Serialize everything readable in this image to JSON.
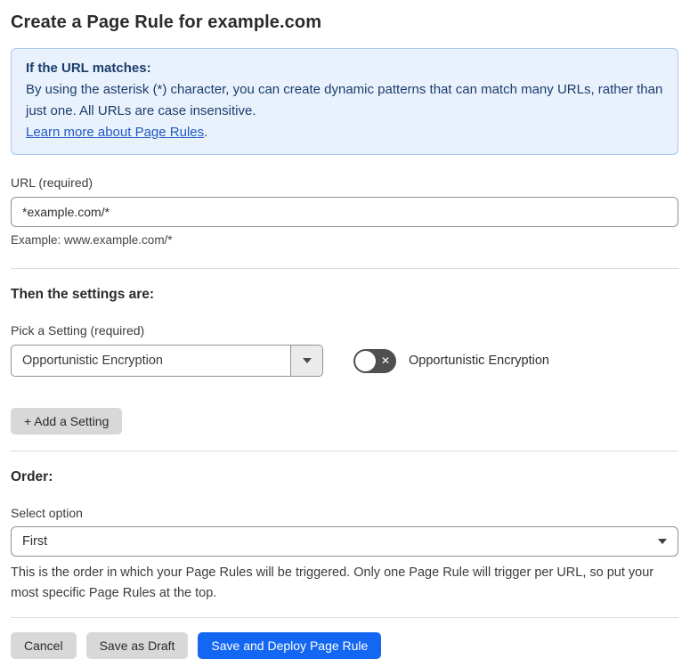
{
  "page": {
    "title": "Create a Page Rule for example.com"
  },
  "info_box": {
    "heading": "If the URL matches:",
    "body": "By using the asterisk (*) character, you can create dynamic patterns that can match many URLs, rather than just one. All URLs are case insensitive.",
    "link_label": "Learn more about Page Rules",
    "link_suffix": "."
  },
  "url_field": {
    "label": "URL (required)",
    "value": "*example.com/*",
    "hint": "Example: www.example.com/*"
  },
  "settings_section": {
    "heading": "Then the settings are:",
    "picker_label": "Pick a Setting (required)",
    "picker_value": "Opportunistic Encryption",
    "toggle_state": "off",
    "toggle_glyph": "✕",
    "toggle_label": "Opportunistic Encryption",
    "add_button_label": "+ Add a Setting"
  },
  "order_section": {
    "heading": "Order:",
    "select_label": "Select option",
    "select_value": "First",
    "help": "This is the order in which your Page Rules will be triggered. Only one Page Rule will trigger per URL, so put your most specific Page Rules at the top."
  },
  "footer": {
    "cancel_label": "Cancel",
    "save_draft_label": "Save as Draft",
    "save_deploy_label": "Save and Deploy Page Rule"
  },
  "colors": {
    "info_bg": "#e9f2fc",
    "info_border": "#a9c8ef",
    "info_text": "#1c3d6e",
    "link_blue": "#2159c4",
    "primary_blue": "#1467f2",
    "toggle_off_bg": "#4f4f4f",
    "gray_button_bg": "#d8d8d8"
  }
}
